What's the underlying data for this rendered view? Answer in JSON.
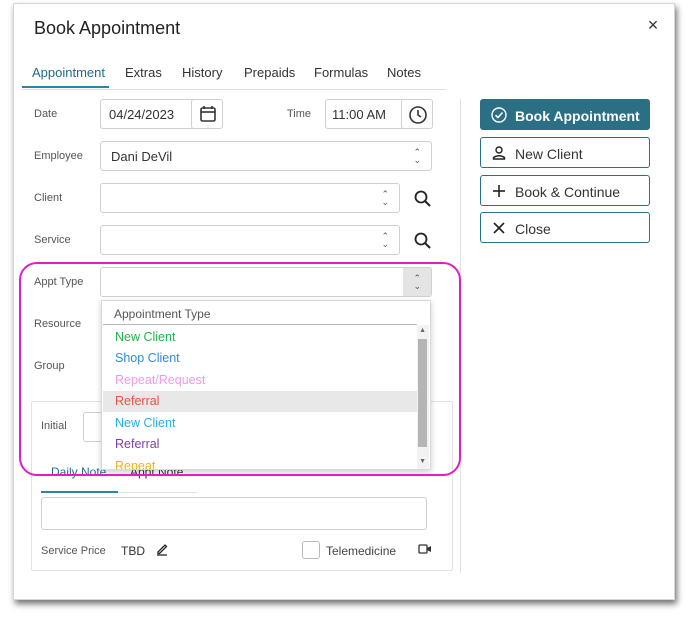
{
  "dialog": {
    "title": "Book Appointment",
    "close_glyph": "×"
  },
  "tabs": [
    "Appointment",
    "Extras",
    "History",
    "Prepaids",
    "Formulas",
    "Notes"
  ],
  "form": {
    "date_label": "Date",
    "date_value": "04/24/2023",
    "time_label": "Time",
    "time_value": "11:00 AM",
    "employee_label": "Employee",
    "employee_value": "Dani DeVil",
    "client_label": "Client",
    "service_label": "Service",
    "appt_type_label": "Appt Type",
    "resource_label": "Resource",
    "group_label": "Group",
    "initial_label": "Initial"
  },
  "dropdown": {
    "header": "Appointment Type",
    "items": [
      {
        "label": "New Client",
        "color": "#22b14c"
      },
      {
        "label": "Shop Client",
        "color": "#2f8be0"
      },
      {
        "label": "Repeat/Request",
        "color": "#f19ae8"
      },
      {
        "label": "Referral",
        "color": "#e9503f"
      },
      {
        "label": "New Client",
        "color": "#22b2e6"
      },
      {
        "label": "Referral",
        "color": "#7b3ea9"
      },
      {
        "label": "Repeat",
        "color": "#f1b313"
      }
    ],
    "highlighted_index": 3
  },
  "actions": {
    "book": "Book Appointment",
    "new_client": "New Client",
    "book_continue": "Book & Continue",
    "close": "Close"
  },
  "notes": {
    "daily_tab": "Daily Note",
    "appt_tab": "Appt Note",
    "service_price_label": "Service Price",
    "service_price_value": "TBD",
    "telemedicine_label": "Telemedicine"
  },
  "colors": {
    "accent": "#2b6f85",
    "highlight_ring": "#e01fbd"
  }
}
